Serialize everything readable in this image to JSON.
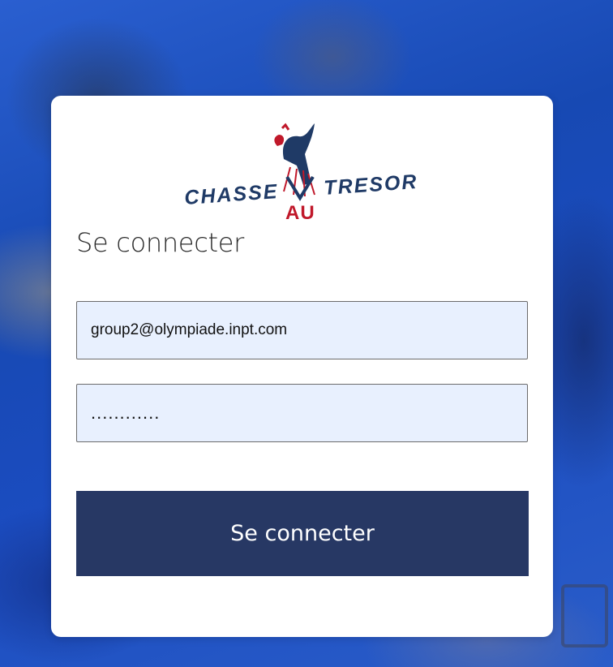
{
  "logo": {
    "text_left": "CHASSE",
    "text_right": "TRESOR",
    "text_bottom": "AU"
  },
  "login": {
    "title": "Se connecter",
    "email_value": "group2@olympiade.inpt.com",
    "password_value": "............",
    "submit_label": "Se connecter"
  },
  "colors": {
    "button_bg": "#273864",
    "input_bg": "#e8f0fe",
    "logo_blue": "#1f3a66",
    "logo_red": "#c0182a"
  }
}
